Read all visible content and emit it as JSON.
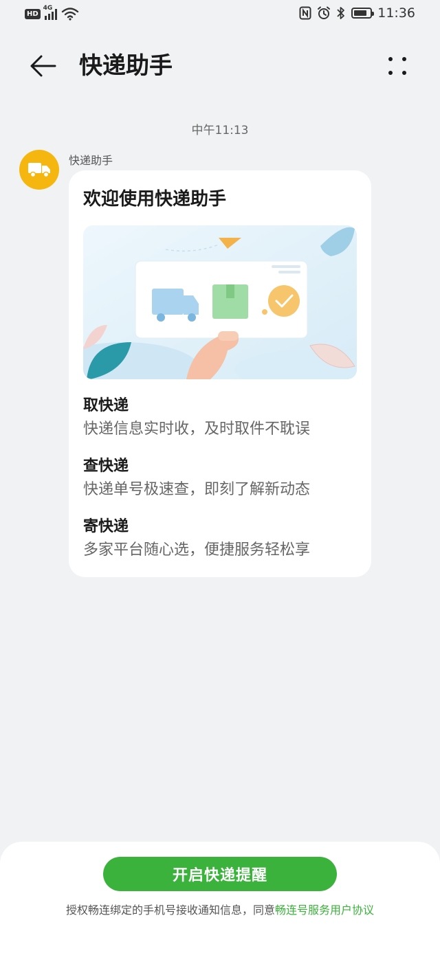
{
  "status_bar": {
    "hd": "HD",
    "network": "4G",
    "time": "11:36",
    "icons": [
      "nfc-icon",
      "alarm-icon",
      "bluetooth-icon",
      "battery-icon"
    ]
  },
  "header": {
    "title": "快递助手",
    "back_icon": "arrow-left-icon",
    "more_icon": "more-dots-icon"
  },
  "chat": {
    "timestamp": "中午11:13",
    "sender": "快递助手",
    "avatar_icon": "truck-icon",
    "card": {
      "title": "欢迎使用快递助手",
      "features": [
        {
          "title": "取快递",
          "desc": "快递信息实时收，及时取件不耽误"
        },
        {
          "title": "查快递",
          "desc": "快递单号极速查，即刻了解新动态"
        },
        {
          "title": "寄快递",
          "desc": "多家平台随心选，便捷服务轻松享"
        }
      ]
    }
  },
  "bottom": {
    "button_label": "开启快递提醒",
    "agreement_prefix": "授权畅连绑定的手机号接收通知信息，同意",
    "agreement_link": "畅连号服务用户协议"
  },
  "colors": {
    "accent": "#3bb23b",
    "avatar_bg": "#f5b70f",
    "background": "#f1f2f4"
  }
}
